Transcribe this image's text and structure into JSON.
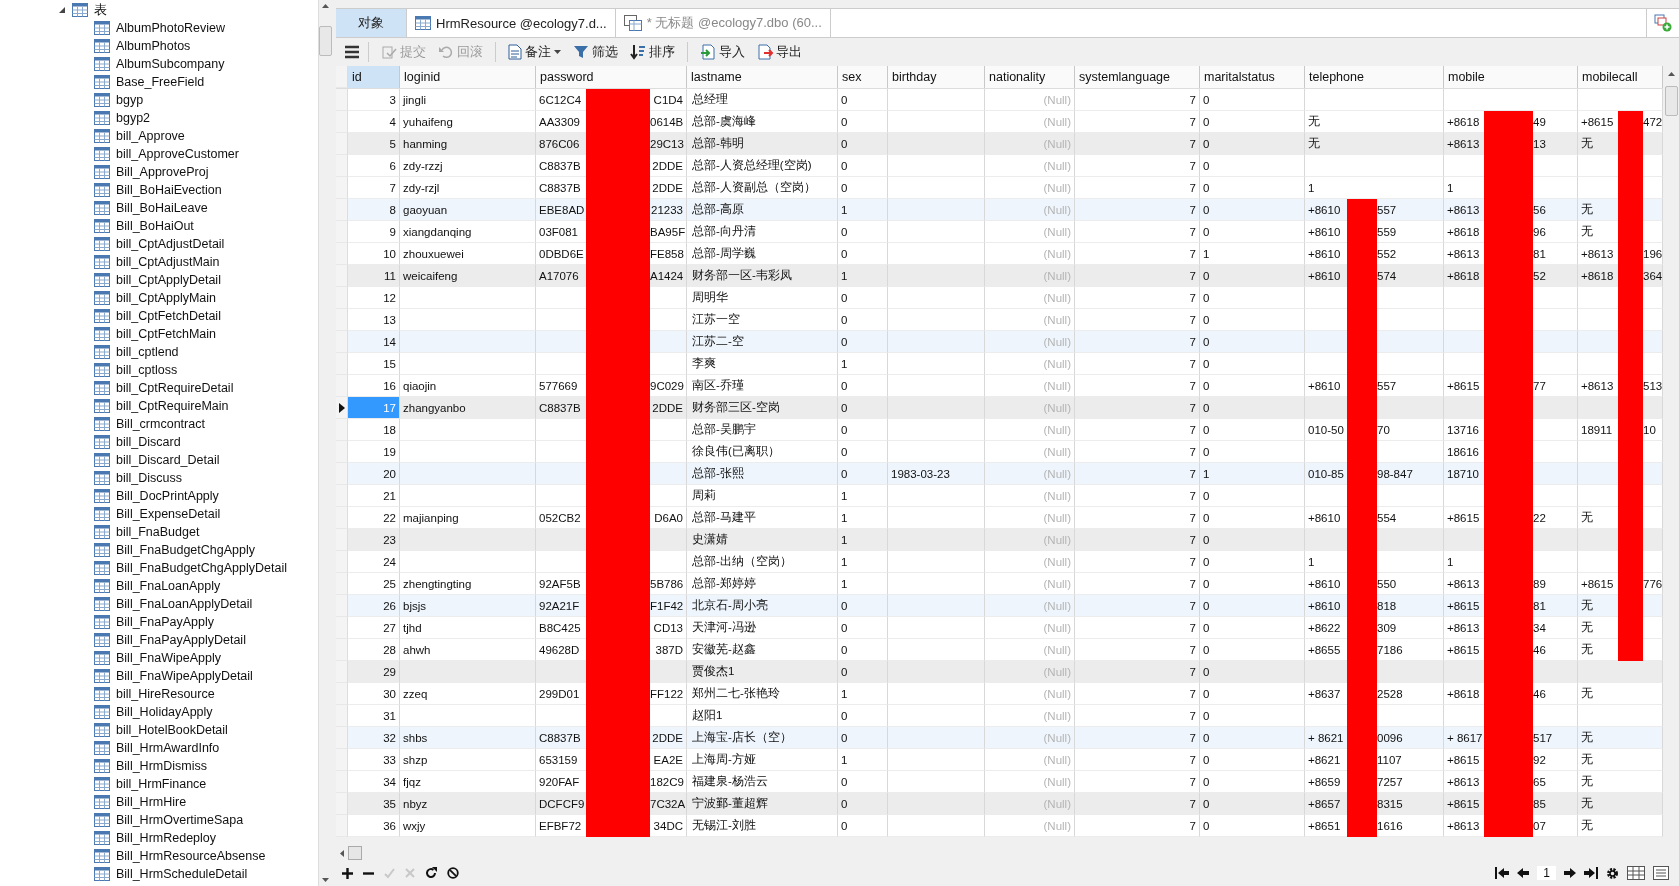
{
  "sidebar": {
    "tree": [
      {
        "label": "表",
        "expanded": true,
        "children": [
          {
            "label": "AlbumPhotoReview"
          },
          {
            "label": "AlbumPhotos"
          },
          {
            "label": "AlbumSubcompany"
          },
          {
            "label": "Base_FreeField"
          },
          {
            "label": "bgyp"
          },
          {
            "label": "bgyp2"
          },
          {
            "label": "bill_Approve"
          },
          {
            "label": "bill_ApproveCustomer"
          },
          {
            "label": "Bill_ApproveProj"
          },
          {
            "label": "Bill_BoHaiEvection"
          },
          {
            "label": "Bill_BoHaiLeave"
          },
          {
            "label": "Bill_BoHaiOut"
          },
          {
            "label": "bill_CptAdjustDetail"
          },
          {
            "label": "bill_CptAdjustMain"
          },
          {
            "label": "bill_CptApplyDetail"
          },
          {
            "label": "bill_CptApplyMain"
          },
          {
            "label": "bill_CptFetchDetail"
          },
          {
            "label": "bill_CptFetchMain"
          },
          {
            "label": "bill_cptlend"
          },
          {
            "label": "bill_cptloss"
          },
          {
            "label": "bill_CptRequireDetail"
          },
          {
            "label": "bill_CptRequireMain"
          },
          {
            "label": "Bill_crmcontract"
          },
          {
            "label": "bill_Discard"
          },
          {
            "label": "bill_Discard_Detail"
          },
          {
            "label": "bill_Discuss"
          },
          {
            "label": "Bill_DocPrintApply"
          },
          {
            "label": "Bill_ExpenseDetail"
          },
          {
            "label": "bill_FnaBudget"
          },
          {
            "label": "Bill_FnaBudgetChgApply"
          },
          {
            "label": "Bill_FnaBudgetChgApplyDetail"
          },
          {
            "label": "Bill_FnaLoanApply"
          },
          {
            "label": "Bill_FnaLoanApplyDetail"
          },
          {
            "label": "Bill_FnaPayApply"
          },
          {
            "label": "Bill_FnaPayApplyDetail"
          },
          {
            "label": "Bill_FnaWipeApply"
          },
          {
            "label": "Bill_FnaWipeApplyDetail"
          },
          {
            "label": "bill_HireResource"
          },
          {
            "label": "Bill_HolidayApply"
          },
          {
            "label": "bill_HotelBookDetail"
          },
          {
            "label": "Bill_HrmAwardInfo"
          },
          {
            "label": "Bill_HrmDismiss"
          },
          {
            "label": "bill_HrmFinance"
          },
          {
            "label": "Bill_HrmHire"
          },
          {
            "label": "Bill_HrmOvertimeSapa"
          },
          {
            "label": "Bill_HrmRedeploy"
          },
          {
            "label": "Bill_HrmResourceAbsense"
          },
          {
            "label": "Bill_HrmScheduleDetail"
          }
        ]
      }
    ]
  },
  "tabs": [
    {
      "label": "对象",
      "kind": "objects",
      "selected": true
    },
    {
      "label": "HrmResource @ecology7.d...",
      "kind": "table",
      "selected": false
    },
    {
      "label": "* 无标题 @ecology7.dbo (60...",
      "kind": "query",
      "selected": false
    }
  ],
  "toolbar": [
    {
      "label": "提交",
      "kind": "commit",
      "disabled": true
    },
    {
      "label": "回滚",
      "kind": "rollback",
      "disabled": true
    },
    {
      "label": "备注",
      "kind": "memo",
      "disabled": false
    },
    {
      "label": "筛选",
      "kind": "filter",
      "disabled": false
    },
    {
      "label": "排序",
      "kind": "sort",
      "disabled": false
    },
    {
      "label": "导入",
      "kind": "import",
      "disabled": false
    },
    {
      "label": "导出",
      "kind": "export",
      "disabled": false
    }
  ],
  "table": {
    "columns": [
      "id",
      "loginid",
      "password",
      "lastname",
      "sex",
      "birthday",
      "nationality",
      "systemlanguage",
      "maritalstatus",
      "telephone",
      "mobile",
      "mobilecall"
    ],
    "rows": [
      {
        "selected": false,
        "cells": [
          "3",
          "jingli",
          {
            "head": "6C12C4",
            "tail": "C1D4"
          },
          "总经理",
          "0",
          null,
          {
            "null": "(Null)"
          },
          "7",
          "0",
          null,
          null,
          null
        ]
      },
      {
        "selected": false,
        "cells": [
          "4",
          "yuhaifeng",
          {
            "head": "AA3309",
            "tail": "0614B"
          },
          "总部-虞海峰",
          "0",
          null,
          {
            "null": "(Null)"
          },
          "7",
          "0",
          "无",
          {
            "head": "+8618",
            "tail": "49"
          },
          {
            "head": "+8615",
            "tail": "472"
          }
        ]
      },
      {
        "selected": false,
        "cells": [
          "5",
          "hanming",
          {
            "head": "876C06",
            "tail": "29C13"
          },
          "总部-韩明",
          "0",
          null,
          {
            "null": "(Null)"
          },
          "7",
          "0",
          "无",
          {
            "head": "+8613",
            "tail": "13"
          },
          "无"
        ]
      },
      {
        "selected": false,
        "cells": [
          "6",
          "zdy-rzzj",
          {
            "head": "C8837B",
            "tail": "2DDE"
          },
          "总部-人资总经理(空岗)",
          "0",
          null,
          {
            "null": "(Null)"
          },
          "7",
          "0",
          null,
          null,
          null
        ]
      },
      {
        "selected": false,
        "cells": [
          "7",
          "zdy-rzjl",
          {
            "head": "C8837B",
            "tail": "2DDE"
          },
          "总部-人资副总（空岗）",
          "0",
          null,
          {
            "null": "(Null)"
          },
          "7",
          "0",
          "1",
          "1",
          null
        ]
      },
      {
        "selected": false,
        "cells": [
          "8",
          "gaoyuan",
          {
            "head": "EBE8AD",
            "tail": "21233"
          },
          "总部-高原",
          "1",
          null,
          {
            "null": "(Null)"
          },
          "7",
          "0",
          {
            "head": "+8610",
            "tail": "557"
          },
          {
            "head": "+8613",
            "tail": "56"
          },
          "无"
        ]
      },
      {
        "selected": false,
        "cells": [
          "9",
          "xiangdanqing",
          {
            "head": "03F081",
            "tail": "BA95F"
          },
          "总部-向丹清",
          "0",
          null,
          {
            "null": "(Null)"
          },
          "7",
          "0",
          {
            "head": "+8610",
            "tail": "559"
          },
          {
            "head": "+8618",
            "tail": "96"
          },
          "无"
        ]
      },
      {
        "selected": false,
        "cells": [
          "10",
          "zhouxuewei",
          {
            "head": "0DBD6E",
            "tail": "FE858"
          },
          "总部-周学巍",
          "0",
          null,
          {
            "null": "(Null)"
          },
          "7",
          "1",
          {
            "head": "+8610",
            "tail": "552"
          },
          {
            "head": "+8613",
            "tail": "81"
          },
          {
            "head": "+8613",
            "tail": "196"
          }
        ]
      },
      {
        "selected": false,
        "cells": [
          "11",
          "weicaifeng",
          {
            "head": "A17076",
            "tail": "A1424"
          },
          "财务部一区-韦彩凤",
          "1",
          null,
          {
            "null": "(Null)"
          },
          "7",
          "0",
          {
            "head": "+8610",
            "tail": "574"
          },
          {
            "head": "+8618",
            "tail": "52"
          },
          {
            "head": "+8618",
            "tail": "364"
          }
        ]
      },
      {
        "selected": false,
        "cells": [
          "12",
          null,
          null,
          "周明华",
          "0",
          null,
          {
            "null": "(Null)"
          },
          "7",
          "0",
          null,
          null,
          null
        ]
      },
      {
        "selected": false,
        "cells": [
          "13",
          null,
          null,
          "江苏一空",
          "0",
          null,
          {
            "null": "(Null)"
          },
          "7",
          "0",
          null,
          null,
          null
        ]
      },
      {
        "selected": false,
        "cells": [
          "14",
          null,
          null,
          "江苏二-空",
          "0",
          null,
          {
            "null": "(Null)"
          },
          "7",
          "0",
          null,
          null,
          null
        ]
      },
      {
        "selected": false,
        "cells": [
          "15",
          null,
          null,
          "李爽",
          "1",
          null,
          {
            "null": "(Null)"
          },
          "7",
          "0",
          null,
          null,
          null
        ]
      },
      {
        "selected": false,
        "cells": [
          "16",
          "qiaojin",
          {
            "head": "577669",
            "tail": "9C029"
          },
          "南区-乔瑾",
          "0",
          null,
          {
            "null": "(Null)"
          },
          "7",
          "0",
          {
            "head": "+8610",
            "tail": "557"
          },
          {
            "head": "+8615",
            "tail": "77"
          },
          {
            "head": "+8613",
            "tail": "513"
          }
        ]
      },
      {
        "selected": true,
        "cells": [
          "17",
          "zhangyanbo",
          {
            "head": "C8837B",
            "tail": "2DDE"
          },
          "财务部三区-空岗",
          "0",
          null,
          {
            "null": "(Null)"
          },
          "7",
          "0",
          null,
          null,
          null
        ]
      },
      {
        "selected": false,
        "cells": [
          "18",
          null,
          null,
          "总部-吴鹏宇",
          "0",
          null,
          {
            "null": "(Null)"
          },
          "7",
          "0",
          {
            "head": "010-50",
            "tail": "70"
          },
          {
            "head": "13716"
          },
          {
            "head": "18911",
            "tail": "10"
          }
        ]
      },
      {
        "selected": false,
        "cells": [
          "19",
          null,
          null,
          "徐良伟(已离职）",
          "0",
          null,
          {
            "null": "(Null)"
          },
          "7",
          "0",
          null,
          {
            "head": "18616"
          },
          null
        ]
      },
      {
        "selected": false,
        "cells": [
          "20",
          null,
          null,
          "总部-张熙",
          "0",
          "1983-03-23",
          {
            "null": "(Null)"
          },
          "7",
          "1",
          {
            "head": "010-85",
            "tail": "98-847"
          },
          {
            "head": "18710"
          },
          null
        ]
      },
      {
        "selected": false,
        "cells": [
          "21",
          null,
          null,
          "周莉",
          "1",
          null,
          {
            "null": "(Null)"
          },
          "7",
          "0",
          null,
          null,
          null
        ]
      },
      {
        "selected": false,
        "cells": [
          "22",
          "majianping",
          {
            "head": "052CB2",
            "tail": "D6A0"
          },
          "总部-马建平",
          "1",
          null,
          {
            "null": "(Null)"
          },
          "7",
          "0",
          {
            "head": "+8610",
            "tail": "554"
          },
          {
            "head": "+8615",
            "tail": "22"
          },
          "无"
        ]
      },
      {
        "selected": false,
        "cells": [
          "23",
          null,
          null,
          "史潇婧",
          "1",
          null,
          {
            "null": "(Null)"
          },
          "7",
          "0",
          null,
          null,
          null
        ]
      },
      {
        "selected": false,
        "cells": [
          "24",
          null,
          null,
          "总部-出纳（空岗）",
          "1",
          null,
          {
            "null": "(Null)"
          },
          "7",
          "0",
          "1",
          "1",
          null
        ]
      },
      {
        "selected": false,
        "cells": [
          "25",
          "zhengtingting",
          {
            "head": "92AF5B",
            "tail": "5B786"
          },
          "总部-郑婷婷",
          "1",
          null,
          {
            "null": "(Null)"
          },
          "7",
          "0",
          {
            "head": "+8610",
            "tail": "550"
          },
          {
            "head": "+8613",
            "tail": "89"
          },
          {
            "head": "+8615",
            "tail": "776"
          }
        ]
      },
      {
        "selected": false,
        "cells": [
          "26",
          "bjsjs",
          {
            "head": "92A21F",
            "tail": "F1F42"
          },
          "北京石-周小亮",
          "0",
          null,
          {
            "null": "(Null)"
          },
          "7",
          "0",
          {
            "head": "+8610",
            "tail": "818"
          },
          {
            "head": "+8615",
            "tail": "81"
          },
          "无"
        ]
      },
      {
        "selected": false,
        "cells": [
          "27",
          "tjhd",
          {
            "head": "B8C425",
            "tail": "CD13"
          },
          "天津河-冯逊",
          "0",
          null,
          {
            "null": "(Null)"
          },
          "7",
          "0",
          {
            "head": "+8622",
            "tail": "309"
          },
          {
            "head": "+8613",
            "tail": "34"
          },
          "无"
        ]
      },
      {
        "selected": false,
        "cells": [
          "28",
          "ahwh",
          {
            "head": "49628D",
            "tail": "387D"
          },
          "安徽芜-赵鑫",
          "0",
          null,
          {
            "null": "(Null)"
          },
          "7",
          "0",
          {
            "head": "+8655",
            "tail": "7186"
          },
          {
            "head": "+8615",
            "tail": "46"
          },
          "无"
        ]
      },
      {
        "selected": false,
        "cells": [
          "29",
          null,
          null,
          "贾俊杰1",
          "0",
          null,
          {
            "null": "(Null)"
          },
          "7",
          "0",
          null,
          null,
          null
        ]
      },
      {
        "selected": false,
        "cells": [
          "30",
          "zzeq",
          {
            "head": "299D01",
            "tail": "FF122"
          },
          "郑州二七-张艳玲",
          "1",
          null,
          {
            "null": "(Null)"
          },
          "7",
          "0",
          {
            "head": "+8637",
            "tail": "2528"
          },
          {
            "head": "+8618",
            "tail": "46"
          },
          "无"
        ]
      },
      {
        "selected": false,
        "cells": [
          "31",
          null,
          null,
          "赵阳1",
          "0",
          null,
          {
            "null": "(Null)"
          },
          "7",
          "0",
          null,
          null,
          null
        ]
      },
      {
        "selected": false,
        "cells": [
          "32",
          "shbs",
          {
            "head": "C8837B",
            "tail": "2DDE"
          },
          "上海宝-店长（空）",
          "0",
          null,
          {
            "null": "(Null)"
          },
          "7",
          "0",
          {
            "head": "+ 8621",
            "tail": "0096"
          },
          {
            "head": "+ 8617",
            "tail": "517"
          },
          "无"
        ]
      },
      {
        "selected": false,
        "cells": [
          "33",
          "shzp",
          {
            "head": "653159",
            "tail": "EA2E"
          },
          "上海周-方娅",
          "1",
          null,
          {
            "null": "(Null)"
          },
          "7",
          "0",
          {
            "head": "+8621",
            "tail": "1107"
          },
          {
            "head": "+8615",
            "tail": "92"
          },
          "无"
        ]
      },
      {
        "selected": false,
        "cells": [
          "34",
          "fjqz",
          {
            "head": "920FAF",
            "tail": "182C9"
          },
          "福建泉-杨浩云",
          "0",
          null,
          {
            "null": "(Null)"
          },
          "7",
          "0",
          {
            "head": "+8659",
            "tail": "7257"
          },
          {
            "head": "+8613",
            "tail": "65"
          },
          "无"
        ]
      },
      {
        "selected": false,
        "cells": [
          "35",
          "nbyz",
          {
            "head": "DCFCF9",
            "tail": "7C32A"
          },
          "宁波鄞-董超辉",
          "0",
          null,
          {
            "null": "(Null)"
          },
          "7",
          "0",
          {
            "head": "+8657",
            "tail": "8315"
          },
          {
            "head": "+8615",
            "tail": "85"
          },
          "无"
        ]
      },
      {
        "selected": false,
        "cells": [
          "36",
          "wxjy",
          {
            "head": "EFBF72",
            "tail": "34DC"
          },
          "无锡江-刘胜",
          "0",
          null,
          {
            "null": "(Null)"
          },
          "7",
          "0",
          {
            "head": "+8651",
            "tail": "1616"
          },
          {
            "head": "+8613",
            "tail": "07"
          },
          "无"
        ]
      }
    ]
  },
  "pager": {
    "page": "1"
  }
}
